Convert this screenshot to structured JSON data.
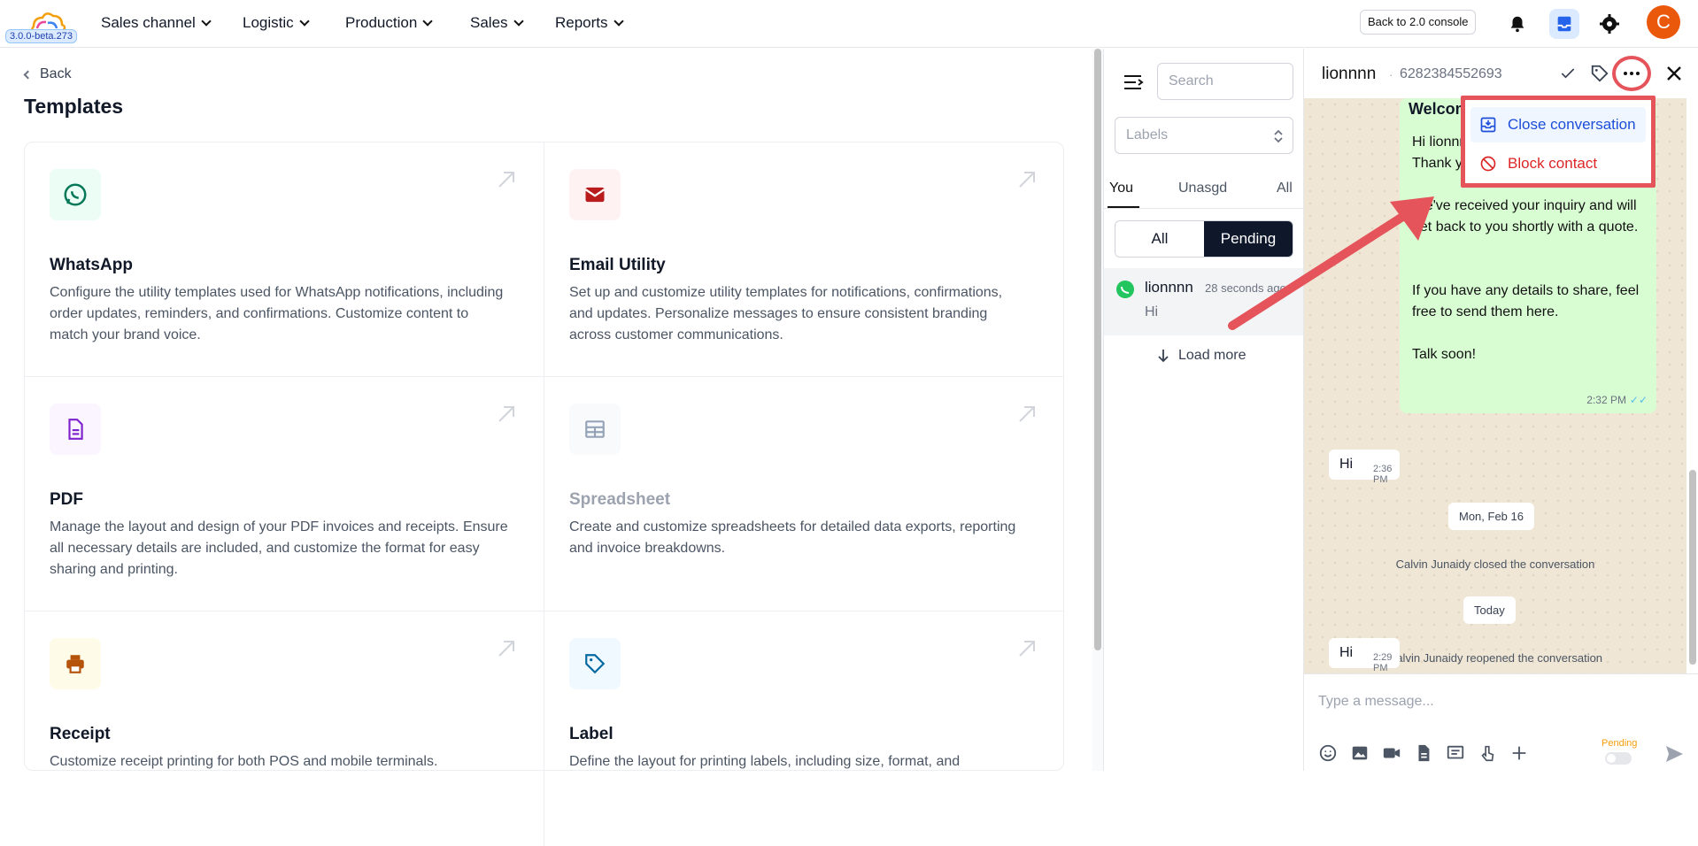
{
  "app": {
    "version": "3.0.0-beta.273",
    "nav": [
      {
        "label": "Sales channel"
      },
      {
        "label": "Logistic"
      },
      {
        "label": "Production"
      },
      {
        "label": "Sales"
      },
      {
        "label": "Reports"
      }
    ],
    "console_button": "Back to 2.0 console",
    "avatar_initial": "C",
    "brand_color": "#ea580c"
  },
  "templates": {
    "back_label": "Back",
    "title": "Templates",
    "cards": [
      {
        "title": "WhatsApp",
        "icon": "whatsapp-icon",
        "description": "Configure the utility templates used for WhatsApp notifications, including order updates, reminders, and confirmations. Customize content to match your brand voice."
      },
      {
        "title": "Email Utility",
        "icon": "mail-icon",
        "description": "Set up and customize utility templates for notifications, confirmations, and updates. Personalize messages to ensure consistent branding across customer communications."
      },
      {
        "title": "PDF",
        "icon": "document-icon",
        "description": "Manage the layout and design of your PDF invoices and receipts. Ensure all necessary details are included, and customize the format for easy sharing and printing."
      },
      {
        "title": "Spreadsheet",
        "icon": "table-icon",
        "description": "Create and customize spreadsheets for detailed data exports, reporting and invoice breakdowns."
      },
      {
        "title": "Receipt",
        "icon": "printer-icon",
        "description": "Customize receipt printing for both POS and mobile terminals."
      },
      {
        "title": "Label",
        "icon": "tag-icon",
        "description": "Define the layout for printing labels, including size, format, and"
      }
    ]
  },
  "inbox": {
    "search_placeholder": "Search",
    "labels_placeholder": "Labels",
    "tabs": [
      {
        "label": "You"
      },
      {
        "label": "Unasgd"
      },
      {
        "label": "All"
      }
    ],
    "segments": [
      {
        "label": "All"
      },
      {
        "label": "Pending"
      }
    ],
    "conversation": {
      "name": "lionnnn",
      "time": "28 seconds ago",
      "preview": "Hi"
    },
    "load_more": "Load more"
  },
  "chat": {
    "name": "lionnnn",
    "phone": "6282384552693",
    "outgoing": {
      "heading": "Welcome",
      "lines": [
        "Hi lionnnn,",
        "Thank you",
        "We've received your inquiry and will get back to you shortly with a quote.",
        "If you have any details to share, feel free to send them here.",
        "Talk soon!"
      ],
      "time": "2:32 PM",
      "ticks": "✓✓"
    },
    "incoming_1": {
      "text": "Hi",
      "time": "2:36 PM"
    },
    "date_1": "Mon, Feb 16",
    "system_1": "Calvin Junaidy closed the conversation",
    "date_2": "Today",
    "system_2": "Calvin Junaidy reopened the conversation",
    "incoming_2": {
      "text": "Hi",
      "time": "2:29 PM"
    },
    "compose_placeholder": "Type a message...",
    "status_label": "Pending"
  },
  "menu": {
    "close_conversation": "Close conversation",
    "block_contact": "Block contact"
  }
}
